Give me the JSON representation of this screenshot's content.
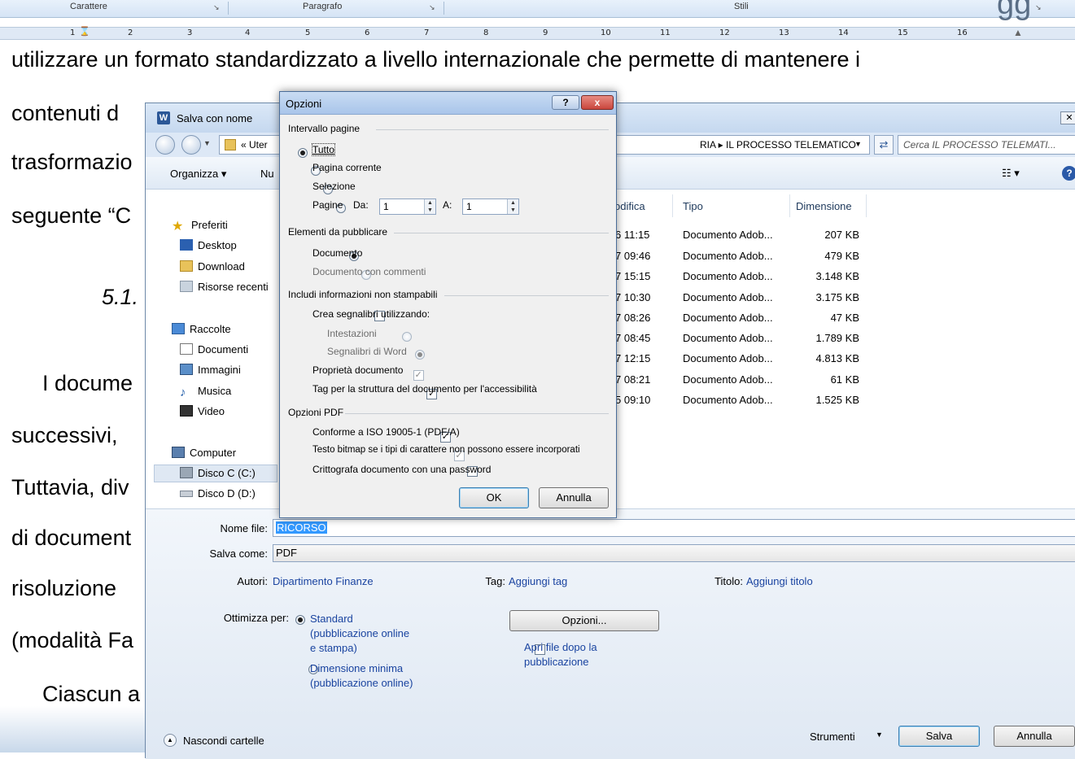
{
  "ribbon": {
    "groups": [
      "Carattere",
      "Paragrafo",
      "Stili"
    ],
    "ruler_numbers": [
      "1",
      "2",
      "3",
      "4",
      "5",
      "6",
      "7",
      "8",
      "9",
      "10",
      "11",
      "12",
      "13",
      "14",
      "15",
      "16"
    ]
  },
  "document": {
    "lines": [
      "utilizzare un formato standardizzato a livello internazionale che permette di mantenere i",
      "contenuti d",
      "trasformazio",
      "seguente “C",
      "5.1.",
      "I docume",
      "successivi,",
      "Tuttavia, div",
      "di document",
      "risoluzione",
      "(modalità Fa",
      "Ciascun a"
    ]
  },
  "save_dialog": {
    "title": "Salva con nome",
    "app_icon": "W",
    "path_prefix": "« Uter",
    "path_tail": "RIA ▸ IL PROCESSO TELEMATICO",
    "search_placeholder": "Cerca IL PROCESSO TELEMATI...",
    "toolbar": {
      "organize": "Organizza ▾",
      "new_folder": "Nu"
    },
    "nav": {
      "favorites": "Preferiti",
      "desktop": "Desktop",
      "download": "Download",
      "recent": "Risorse recenti",
      "libraries": "Raccolte",
      "documents": "Documenti",
      "images": "Immagini",
      "music": "Musica",
      "video": "Video",
      "computer": "Computer",
      "disk_c": "Disco C (C:)",
      "disk_d": "Disco D (D:)"
    },
    "columns": {
      "modified": "odifica",
      "type": "Tipo",
      "size": "Dimensione"
    },
    "files": [
      {
        "modified": "6 11:15",
        "type": "Documento Adob...",
        "size": "207 KB"
      },
      {
        "modified": "7 09:46",
        "type": "Documento Adob...",
        "size": "479 KB"
      },
      {
        "modified": "7 15:15",
        "type": "Documento Adob...",
        "size": "3.148 KB"
      },
      {
        "modified": "7 10:30",
        "type": "Documento Adob...",
        "size": "3.175 KB"
      },
      {
        "modified": "7 08:26",
        "type": "Documento Adob...",
        "size": "47 KB"
      },
      {
        "modified": "7 08:45",
        "type": "Documento Adob...",
        "size": "1.789 KB"
      },
      {
        "modified": "7 12:15",
        "type": "Documento Adob...",
        "size": "4.813 KB"
      },
      {
        "modified": "7 08:21",
        "type": "Documento Adob...",
        "size": "61 KB"
      },
      {
        "modified": "5 09:10",
        "type": "Documento Adob...",
        "size": "1.525 KB"
      }
    ],
    "filename_label": "Nome file:",
    "filename_value": "RICORSO",
    "saveas_label": "Salva come:",
    "saveas_value": "PDF",
    "authors_label": "Autori:",
    "authors_value": "Dipartimento Finanze",
    "tag_label": "Tag:",
    "tag_value": "Aggiungi tag",
    "titolo_label": "Titolo:",
    "titolo_value": "Aggiungi titolo",
    "optimize_label": "Ottimizza per:",
    "optimize_standard": [
      "Standard",
      "(pubblicazione online",
      "e stampa)"
    ],
    "optimize_min": [
      "Dimensione minima",
      "(pubblicazione online)"
    ],
    "options_button": "Opzioni...",
    "open_after": [
      "Apri file dopo la",
      "pubblicazione"
    ],
    "hide_folders": "Nascondi cartelle",
    "tools": "Strumenti",
    "save": "Salva",
    "cancel": "Annulla"
  },
  "options_dialog": {
    "title": "Opzioni",
    "help": "?",
    "close": "x",
    "page_range": {
      "title": "Intervallo pagine",
      "all": "Tutto",
      "current": "Pagina corrente",
      "selection": "Selezione",
      "pages": "Pagine",
      "from_label": "Da:",
      "from_value": "1",
      "to_label": "A:",
      "to_value": "1"
    },
    "publish": {
      "title": "Elementi da pubblicare",
      "document": "Documento",
      "with_comments": "Documento con commenti"
    },
    "nonprint": {
      "title": "Includi informazioni non stampabili",
      "bookmarks": "Crea segnalibri utilizzando:",
      "headings": "Intestazioni",
      "word_bookmarks": "Segnalibri di Word",
      "properties": "Proprietà documento",
      "tags": "Tag per la struttura del documento per l'accessibilità"
    },
    "pdf": {
      "title": "Opzioni PDF",
      "iso": "Conforme a ISO 19005-1 (PDF/A)",
      "bitmap": "Testo bitmap se i tipi di carattere non possono essere incorporati",
      "encrypt": "Crittografa documento con una password"
    },
    "ok": "OK",
    "cancel": "Annulla"
  },
  "colors": {
    "link": "#1a44a0",
    "title_close": "#c9463d",
    "selection": "#3399ff"
  }
}
